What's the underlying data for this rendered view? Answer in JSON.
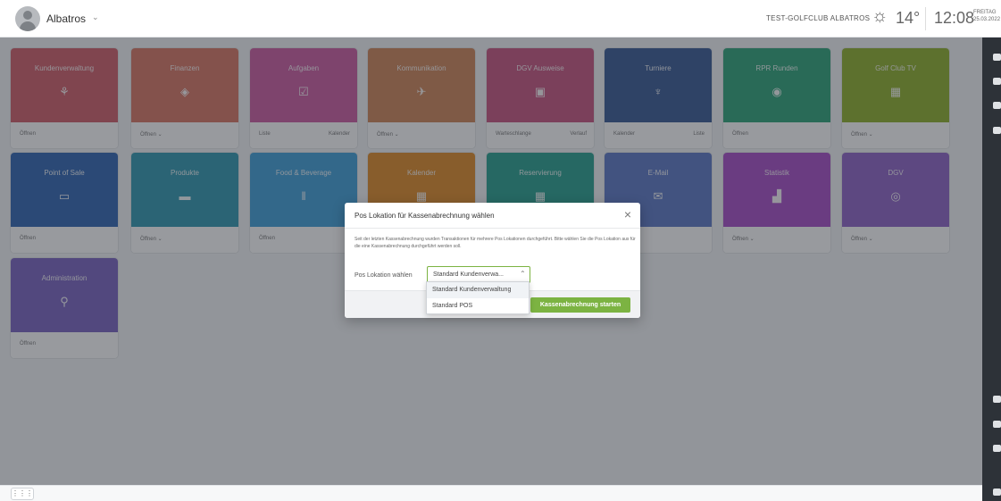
{
  "header": {
    "user_name": "Albatros",
    "user_caret": "⌄",
    "club": "TEST-GOLFCLUB ALBATROS",
    "weather_icon": "☼",
    "temperature": "14°",
    "time": "12:08",
    "day": "FREITAG",
    "date": "25.03.2022"
  },
  "tiles": [
    {
      "title": "Kundenverwaltung",
      "icon": "⚘",
      "footer_left": "Öffnen",
      "footer_right": "",
      "color": "#d15d68"
    },
    {
      "title": "Finanzen",
      "icon": "◈",
      "footer_left": "Öffnen ⌄",
      "footer_right": "",
      "color": "#d87663"
    },
    {
      "title": "Aufgaben",
      "icon": "☑",
      "footer_left": "Liste",
      "footer_right": "Kalender",
      "color": "#cd5aa1"
    },
    {
      "title": "Kommunikation",
      "icon": "✈",
      "footer_left": "Öffnen ⌄",
      "footer_right": "",
      "color": "#d08456"
    },
    {
      "title": "DGV Ausweise",
      "icon": "▣",
      "footer_left": "Warteschlange",
      "footer_right": "Verlauf",
      "color": "#c7547f"
    },
    {
      "title": "Turniere",
      "icon": "♆",
      "footer_left": "Kalender",
      "footer_right": "Liste",
      "color": "#365995"
    },
    {
      "title": "RPR Runden",
      "icon": "◉",
      "footer_left": "Öffnen",
      "footer_right": "",
      "color": "#2ba477"
    },
    {
      "title": "Golf Club TV",
      "icon": "▦",
      "footer_left": "Öffnen ⌄",
      "footer_right": "",
      "color": "#8fb12a"
    },
    {
      "title": "Point of Sale",
      "icon": "▭",
      "footer_left": "Öffnen",
      "footer_right": "",
      "color": "#2f65b2"
    },
    {
      "title": "Produkte",
      "icon": "▬",
      "footer_left": "Öffnen ⌄",
      "footer_right": "",
      "color": "#2f98b0"
    },
    {
      "title": "Food & Beverage",
      "icon": "ǁ",
      "footer_left": "Öffnen",
      "footer_right": "",
      "color": "#3e9fd9"
    },
    {
      "title": "Kalender",
      "icon": "▦",
      "footer_left": "",
      "footer_right": "",
      "color": "#e08a26"
    },
    {
      "title": "Reservierung",
      "icon": "▦",
      "footer_left": "",
      "footer_right": "",
      "color": "#25a08f"
    },
    {
      "title": "E-Mail",
      "icon": "✉",
      "footer_left": "",
      "footer_right": "",
      "color": "#5b77c6"
    },
    {
      "title": "Statistik",
      "icon": "▟",
      "footer_left": "Öffnen ⌄",
      "footer_right": "",
      "color": "#a84bc8"
    },
    {
      "title": "DGV",
      "icon": "◎",
      "footer_left": "Öffnen ⌄",
      "footer_right": "",
      "color": "#8f62c7"
    },
    {
      "title": "Administration",
      "icon": "⚲",
      "footer_left": "Öffnen",
      "footer_right": "",
      "color": "#7a63c1"
    }
  ],
  "modal": {
    "title": "Pos Lokation für Kassenabrechnung wählen",
    "close": "×",
    "text": "Seit der letzten Kassenabrechnung wurden Transaktionen für mehrere Pos Lokationen durchgeführt. Bitte wählen Sie die Pos Lokation aus für die eine Kassenabrechnung durchgeführt werden soll.",
    "field_label": "Pos Lokation wählen",
    "selected_value": "Standard Kundenverwa...",
    "caret": "⌃",
    "options": [
      "Standard Kundenverwaltung",
      "Standard POS"
    ],
    "start_button": "Kassenabrechnung starten"
  },
  "bottom": {
    "apps_icon": "⋮⋮⋮"
  }
}
